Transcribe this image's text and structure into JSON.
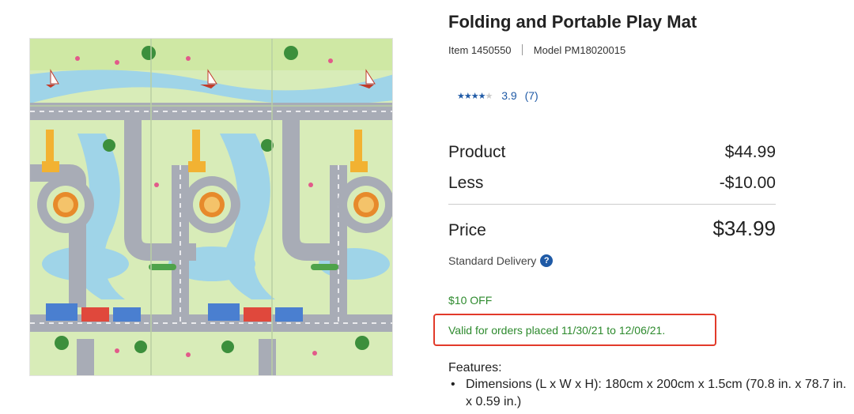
{
  "product": {
    "image_alt": "Folding and Portable Play Mat image",
    "title": "Folding and Portable Play Mat",
    "item_label": "Item",
    "item_number": "1450550",
    "model_label": "Model",
    "model_number": "PM18020015",
    "rating": {
      "stars_filled": "★★★★",
      "stars_empty": "★",
      "value": "3.9",
      "count": "(7)"
    }
  },
  "pricing": {
    "product_label": "Product",
    "product_value": "$44.99",
    "less_label": "Less",
    "less_value": "-$10.00",
    "price_label": "Price",
    "price_value": "$34.99",
    "delivery_label": "Standard Delivery",
    "delivery_help_icon": "?"
  },
  "promo": {
    "title": "$10 OFF",
    "validity": "Valid for orders placed 11/30/21 to 12/06/21."
  },
  "features": {
    "heading": "Features:",
    "items": [
      "Dimensions (L x W x H): 180cm x 200cm x 1.5cm (70.8 in. x 78.7 in. x 0.59 in.)"
    ]
  },
  "colors": {
    "link_blue": "#1f5aa6",
    "promo_green": "#2d8a2d",
    "highlight_red": "#e23a2a"
  }
}
